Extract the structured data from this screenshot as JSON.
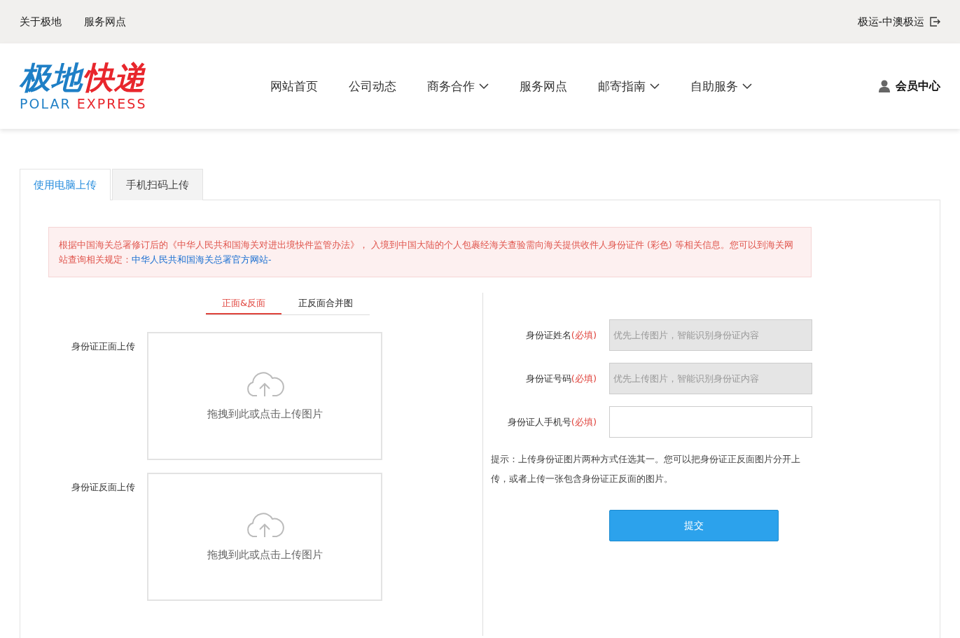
{
  "top_bar": {
    "links": [
      "关于极地",
      "服务网点"
    ],
    "account": "极运-中澳极运"
  },
  "logo": {
    "cn_blue": "极地",
    "cn_red": "快递",
    "en_blue": "POLAR",
    "en_red": "EXPRESS"
  },
  "nav": [
    {
      "label": "网站首页",
      "has_dropdown": false
    },
    {
      "label": "公司动态",
      "has_dropdown": false
    },
    {
      "label": "商务合作",
      "has_dropdown": true
    },
    {
      "label": "服务网点",
      "has_dropdown": false
    },
    {
      "label": "邮寄指南",
      "has_dropdown": true
    },
    {
      "label": "自助服务",
      "has_dropdown": true
    }
  ],
  "member": "会员中心",
  "tabs": [
    {
      "label": "使用电脑上传",
      "selected": true
    },
    {
      "label": "手机扫码上传",
      "selected": false
    }
  ],
  "notice": {
    "text": "根据中国海关总署修订后的《中华人民共和国海关对进出境快件监管办法》， 入境到中国大陆的个人包裹经海关查验需向海关提供收件人身份证件 (彩色) 等相关信息。您可以到海关网站查询相关规定：",
    "link": "中华人民共和国海关总署官方网站-"
  },
  "upload_modes": [
    {
      "label": "正面&反面",
      "selected": true
    },
    {
      "label": "正反面合并图",
      "selected": false
    }
  ],
  "uploads": [
    {
      "label": "身份证正面上传",
      "hint": "拖拽到此或点击上传图片"
    },
    {
      "label": "身份证反面上传",
      "hint": "拖拽到此或点击上传图片"
    }
  ],
  "fields": [
    {
      "label": "身份证姓名",
      "required": "(必填)",
      "placeholder": "优先上传图片，智能识别身份证内容",
      "disabled": true
    },
    {
      "label": "身份证号码",
      "required": "(必填)",
      "placeholder": "优先上传图片，智能识别身份证内容",
      "disabled": true
    },
    {
      "label": "身份证人手机号",
      "required": "(必填)",
      "disabled": false
    }
  ],
  "tip": "提示：上传身份证图片两种方式任选其一。您可以把身份证正反面图片分开上传，或者上传一张包含身份证正反面的图片。",
  "submit": "提交"
}
